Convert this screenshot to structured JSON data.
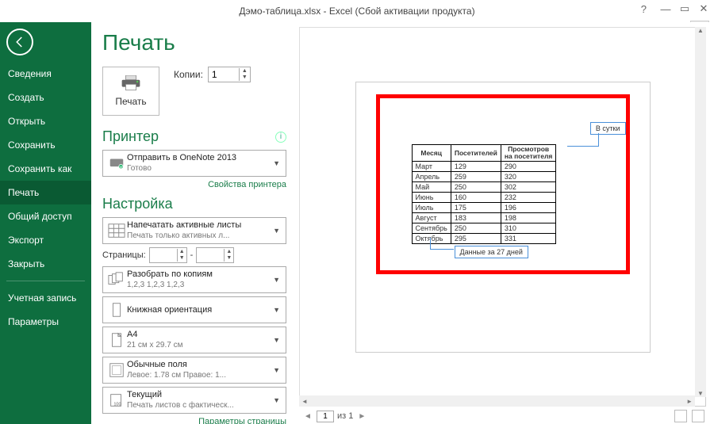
{
  "window": {
    "title": "Дэмо-таблица.xlsx - Excel (Сбой активации продукта)"
  },
  "sidebar": {
    "items": [
      {
        "label": "Сведения"
      },
      {
        "label": "Создать"
      },
      {
        "label": "Открыть"
      },
      {
        "label": "Сохранить"
      },
      {
        "label": "Сохранить как"
      },
      {
        "label": "Печать"
      },
      {
        "label": "Общий доступ"
      },
      {
        "label": "Экспорт"
      },
      {
        "label": "Закрыть"
      }
    ],
    "bottom": [
      {
        "label": "Учетная запись"
      },
      {
        "label": "Параметры"
      }
    ],
    "selected": "Печать"
  },
  "page": {
    "title": "Печать",
    "print_button": "Печать",
    "copies_label": "Копии:",
    "copies_value": "1"
  },
  "printer": {
    "heading": "Принтер",
    "name": "Отправить в OneNote 2013",
    "status": "Готово",
    "props_link": "Свойства принтера"
  },
  "settings": {
    "heading": "Настройка",
    "active_sheets": {
      "l1": "Напечатать активные листы",
      "l2": "Печать только активных л..."
    },
    "pages_label": "Страницы:",
    "pages_dash": "-",
    "collate": {
      "l1": "Разобрать по копиям",
      "l2": "1,2,3   1,2,3   1,2,3"
    },
    "orientation": {
      "l1": "Книжная ориентация",
      "l2": ""
    },
    "paper": {
      "l1": "A4",
      "l2": "21 см x 29.7 см"
    },
    "margins": {
      "l1": "Обычные поля",
      "l2": "Левое:  1.78 см   Правое:  1..."
    },
    "scaling": {
      "l1": "Текущий",
      "l2": "Печать листов с фактическ..."
    },
    "page_setup_link": "Параметры страницы"
  },
  "preview": {
    "callout1": "В сутки",
    "callout2": "Данные за 27 дней",
    "page_current": "1",
    "page_of": "из 1"
  },
  "chart_data": {
    "type": "table",
    "title": "",
    "columns": [
      "Месяц",
      "Посетителей",
      "Просмотров на посетителя"
    ],
    "rows": [
      [
        "Март",
        "129",
        "290"
      ],
      [
        "Апрель",
        "259",
        "320"
      ],
      [
        "Май",
        "250",
        "302"
      ],
      [
        "Июнь",
        "160",
        "232"
      ],
      [
        "Июль",
        "175",
        "196"
      ],
      [
        "Август",
        "183",
        "198"
      ],
      [
        "Сентябрь",
        "250",
        "310"
      ],
      [
        "Октябрь",
        "295",
        "331"
      ]
    ]
  }
}
